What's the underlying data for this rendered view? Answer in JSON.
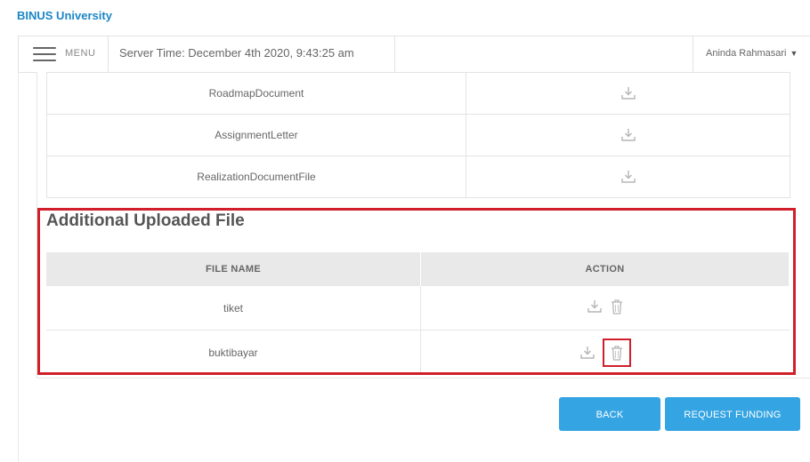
{
  "brand": "BINUS University",
  "header": {
    "menu_label": "MENU",
    "server_time": "Server Time: December 4th 2020, 9:43:25 am",
    "user_name": "Aninda Rahmasari"
  },
  "documents": [
    {
      "name": "RoadmapDocument"
    },
    {
      "name": "AssignmentLetter"
    },
    {
      "name": "RealizationDocumentFile"
    }
  ],
  "additional": {
    "title": "Additional Uploaded File",
    "columns": {
      "file_name": "FILE NAME",
      "action": "ACTION"
    },
    "files": [
      {
        "name": "tiket"
      },
      {
        "name": "buktibayar"
      }
    ]
  },
  "buttons": {
    "back": "BACK",
    "request_funding": "REQUEST FUNDING"
  },
  "colors": {
    "brand": "#1b86c4",
    "button": "#35a4e3",
    "highlight": "#d01f2a"
  }
}
